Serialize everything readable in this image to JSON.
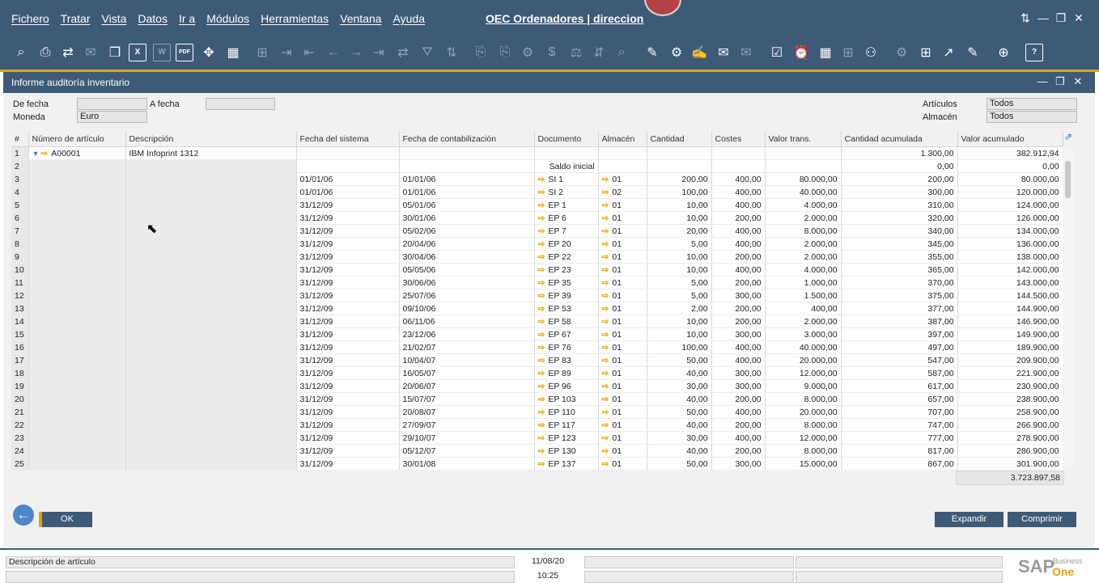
{
  "menu": [
    "Fichero",
    "Tratar",
    "Vista",
    "Datos",
    "Ir a",
    "Módulos",
    "Herramientas",
    "Ventana",
    "Ayuda"
  ],
  "app_title": "OEC Ordenadores | direccion",
  "window_controls": {
    "settings": "⇅",
    "minimize": "—",
    "restore": "❐",
    "close": "✕"
  },
  "form": {
    "title": "Informe auditoría inventario",
    "de_fecha_label": "De fecha",
    "a_fecha_label": "A fecha",
    "moneda_label": "Moneda",
    "moneda_value": "Euro",
    "articulos_label": "Artículos",
    "articulos_value": "Todos",
    "almacen_label": "Almacén",
    "almacen_value": "Todos"
  },
  "table": {
    "headers": [
      "#",
      "Número de artículo",
      "Descripción",
      "Fecha del sistema",
      "Fecha de contabilización",
      "Documento",
      "Almacén",
      "Cantidad",
      "Costes",
      "Valor trans.",
      "Cantidad acumulada",
      "Valor acumulado"
    ],
    "item_row": {
      "num": "1",
      "item": "A00001",
      "desc": "IBM Infoprint 1312",
      "cum_qty": "1.300,00",
      "cum_val": "382.912,94"
    },
    "opening_row": {
      "num": "2",
      "doc": "Saldo inicial",
      "cum_qty": "0,00",
      "cum_val": "0,00"
    },
    "rows": [
      [
        "3",
        "01/01/06",
        "01/01/06",
        "SI 1",
        "01",
        "200,00",
        "400,00",
        "80.000,00",
        "200,00",
        "80.000,00"
      ],
      [
        "4",
        "01/01/06",
        "01/01/06",
        "SI 2",
        "02",
        "100,00",
        "400,00",
        "40.000,00",
        "300,00",
        "120.000,00"
      ],
      [
        "5",
        "31/12/09",
        "05/01/06",
        "EP 1",
        "01",
        "10,00",
        "400,00",
        "4.000,00",
        "310,00",
        "124.000,00"
      ],
      [
        "6",
        "31/12/09",
        "30/01/06",
        "EP 6",
        "01",
        "10,00",
        "200,00",
        "2.000,00",
        "320,00",
        "126.000,00"
      ],
      [
        "7",
        "31/12/09",
        "05/02/06",
        "EP 7",
        "01",
        "20,00",
        "400,00",
        "8.000,00",
        "340,00",
        "134.000,00"
      ],
      [
        "8",
        "31/12/09",
        "20/04/06",
        "EP 20",
        "01",
        "5,00",
        "400,00",
        "2.000,00",
        "345,00",
        "136.000,00"
      ],
      [
        "9",
        "31/12/09",
        "30/04/06",
        "EP 22",
        "01",
        "10,00",
        "200,00",
        "2.000,00",
        "355,00",
        "138.000,00"
      ],
      [
        "10",
        "31/12/09",
        "05/05/06",
        "EP 23",
        "01",
        "10,00",
        "400,00",
        "4.000,00",
        "365,00",
        "142.000,00"
      ],
      [
        "11",
        "31/12/09",
        "30/06/06",
        "EP 35",
        "01",
        "5,00",
        "200,00",
        "1.000,00",
        "370,00",
        "143.000,00"
      ],
      [
        "12",
        "31/12/09",
        "25/07/06",
        "EP 39",
        "01",
        "5,00",
        "300,00",
        "1.500,00",
        "375,00",
        "144.500,00"
      ],
      [
        "13",
        "31/12/09",
        "09/10/06",
        "EP 53",
        "01",
        "2,00",
        "200,00",
        "400,00",
        "377,00",
        "144.900,00"
      ],
      [
        "14",
        "31/12/09",
        "06/11/06",
        "EP 58",
        "01",
        "10,00",
        "200,00",
        "2.000,00",
        "387,00",
        "146.900,00"
      ],
      [
        "15",
        "31/12/09",
        "23/12/06",
        "EP 67",
        "01",
        "10,00",
        "300,00",
        "3.000,00",
        "397,00",
        "149.900,00"
      ],
      [
        "16",
        "31/12/09",
        "21/02/07",
        "EP 76",
        "01",
        "100,00",
        "400,00",
        "40.000,00",
        "497,00",
        "189.900,00"
      ],
      [
        "17",
        "31/12/09",
        "10/04/07",
        "EP 83",
        "01",
        "50,00",
        "400,00",
        "20.000,00",
        "547,00",
        "209.900,00"
      ],
      [
        "18",
        "31/12/09",
        "16/05/07",
        "EP 89",
        "01",
        "40,00",
        "300,00",
        "12.000,00",
        "587,00",
        "221.900,00"
      ],
      [
        "19",
        "31/12/09",
        "20/06/07",
        "EP 96",
        "01",
        "30,00",
        "300,00",
        "9.000,00",
        "617,00",
        "230.900,00"
      ],
      [
        "20",
        "31/12/09",
        "15/07/07",
        "EP 103",
        "01",
        "40,00",
        "200,00",
        "8.000,00",
        "657,00",
        "238.900,00"
      ],
      [
        "21",
        "31/12/09",
        "20/08/07",
        "EP 110",
        "01",
        "50,00",
        "400,00",
        "20.000,00",
        "707,00",
        "258.900,00"
      ],
      [
        "22",
        "31/12/09",
        "27/09/07",
        "EP 117",
        "01",
        "40,00",
        "200,00",
        "8.000,00",
        "747,00",
        "266.900,00"
      ],
      [
        "23",
        "31/12/09",
        "29/10/07",
        "EP 123",
        "01",
        "30,00",
        "400,00",
        "12.000,00",
        "777,00",
        "278.900,00"
      ],
      [
        "24",
        "31/12/09",
        "05/12/07",
        "EP 130",
        "01",
        "40,00",
        "200,00",
        "8.000,00",
        "817,00",
        "286.900,00"
      ],
      [
        "25",
        "31/12/09",
        "30/01/08",
        "EP 137",
        "01",
        "50,00",
        "300,00",
        "15.000,00",
        "867,00",
        "301.900,00"
      ]
    ],
    "total": "3.723.897,58"
  },
  "buttons": {
    "ok": "OK",
    "expand": "Expandir",
    "collapse": "Comprimir"
  },
  "status": {
    "field_label": "Descripción de artículo",
    "date": "11/08/20",
    "time": "10:25"
  },
  "brand": {
    "sap": "SAP",
    "business": "Business",
    "one": "One"
  },
  "colors": {
    "bar": "#3d5a77",
    "accent": "#e8a200"
  }
}
